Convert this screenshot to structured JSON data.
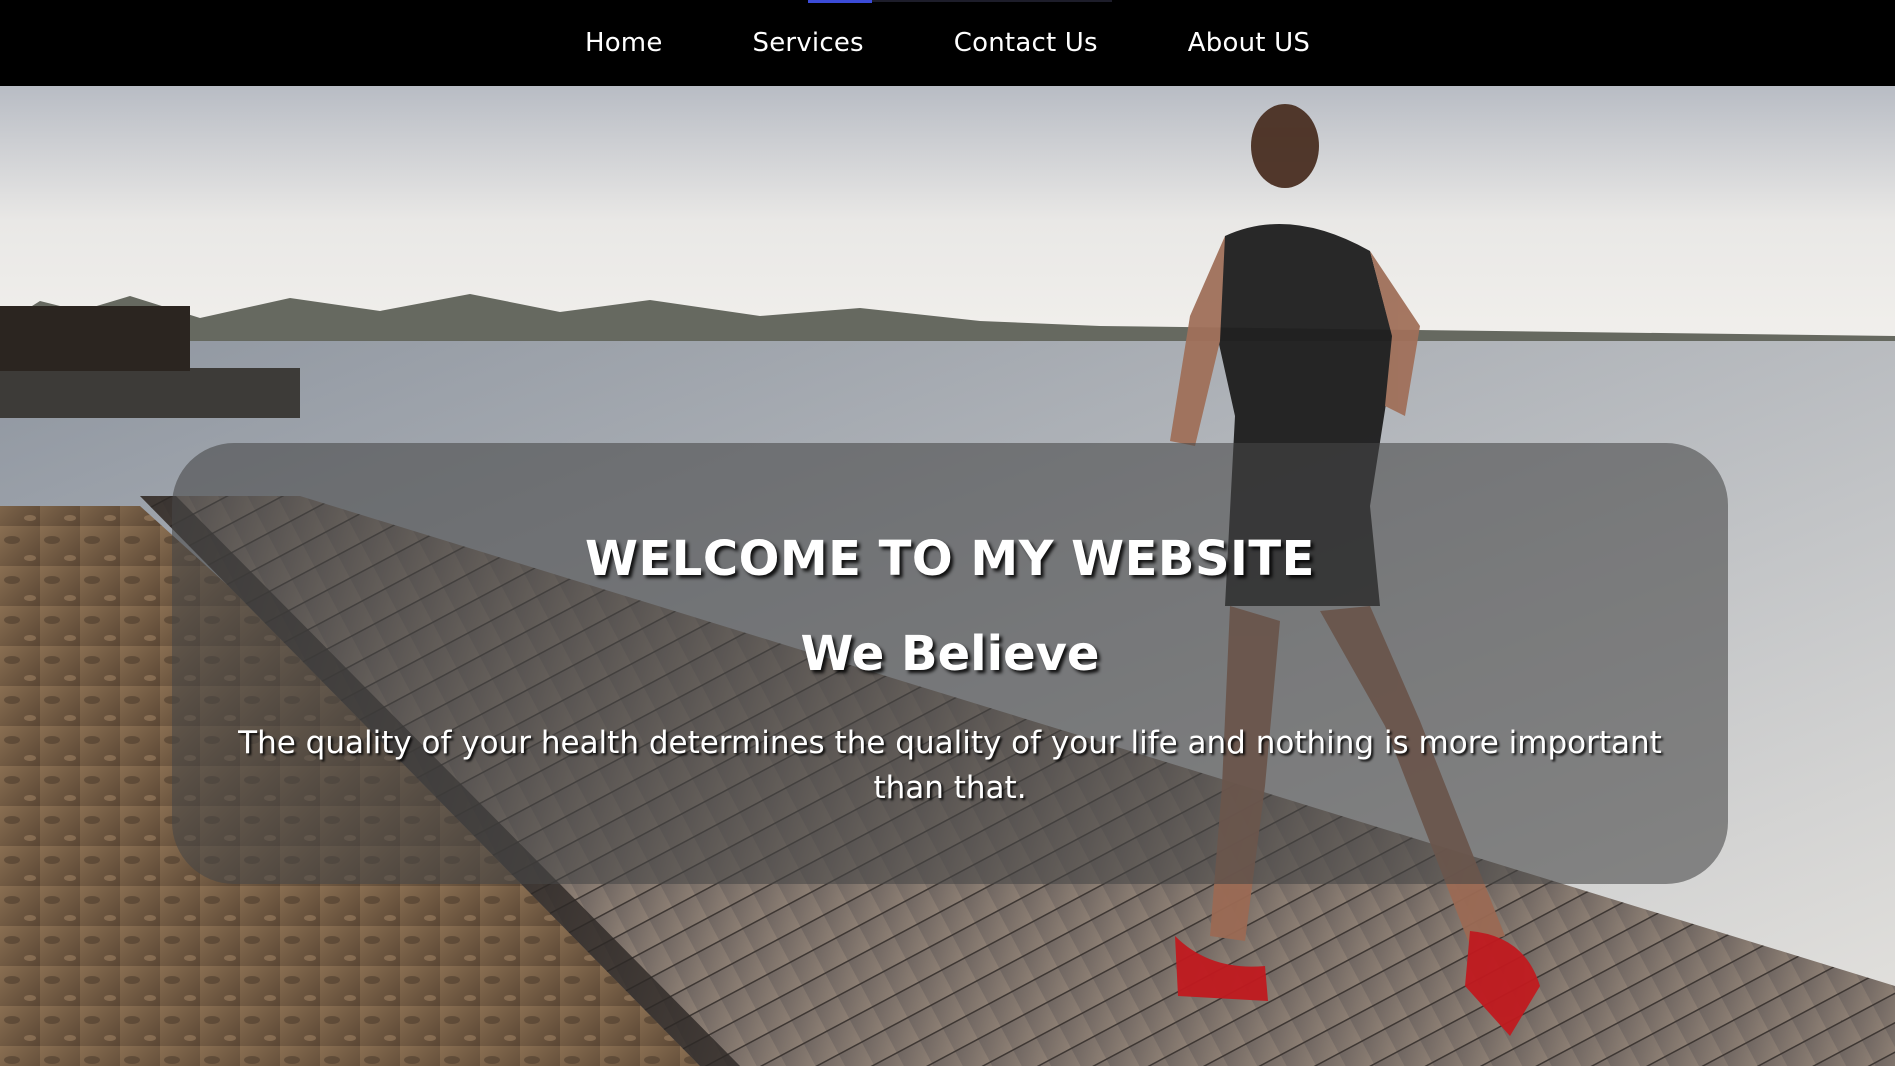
{
  "nav": {
    "items": [
      {
        "label": "Home"
      },
      {
        "label": "Services"
      },
      {
        "label": "Contact Us"
      },
      {
        "label": "About US"
      }
    ]
  },
  "hero": {
    "title": "WELCOME TO MY WEBSITE",
    "subtitle": "We Believe",
    "text": "The quality of your health determines the quality of your life and nothing is more important than that."
  },
  "colors": {
    "nav_background": "#000000",
    "nav_text": "#ffffff",
    "nav_accent": "#3b4bd8",
    "card_overlay": "rgba(70,70,70,0.58)",
    "hero_text": "#ffffff"
  },
  "icons": []
}
